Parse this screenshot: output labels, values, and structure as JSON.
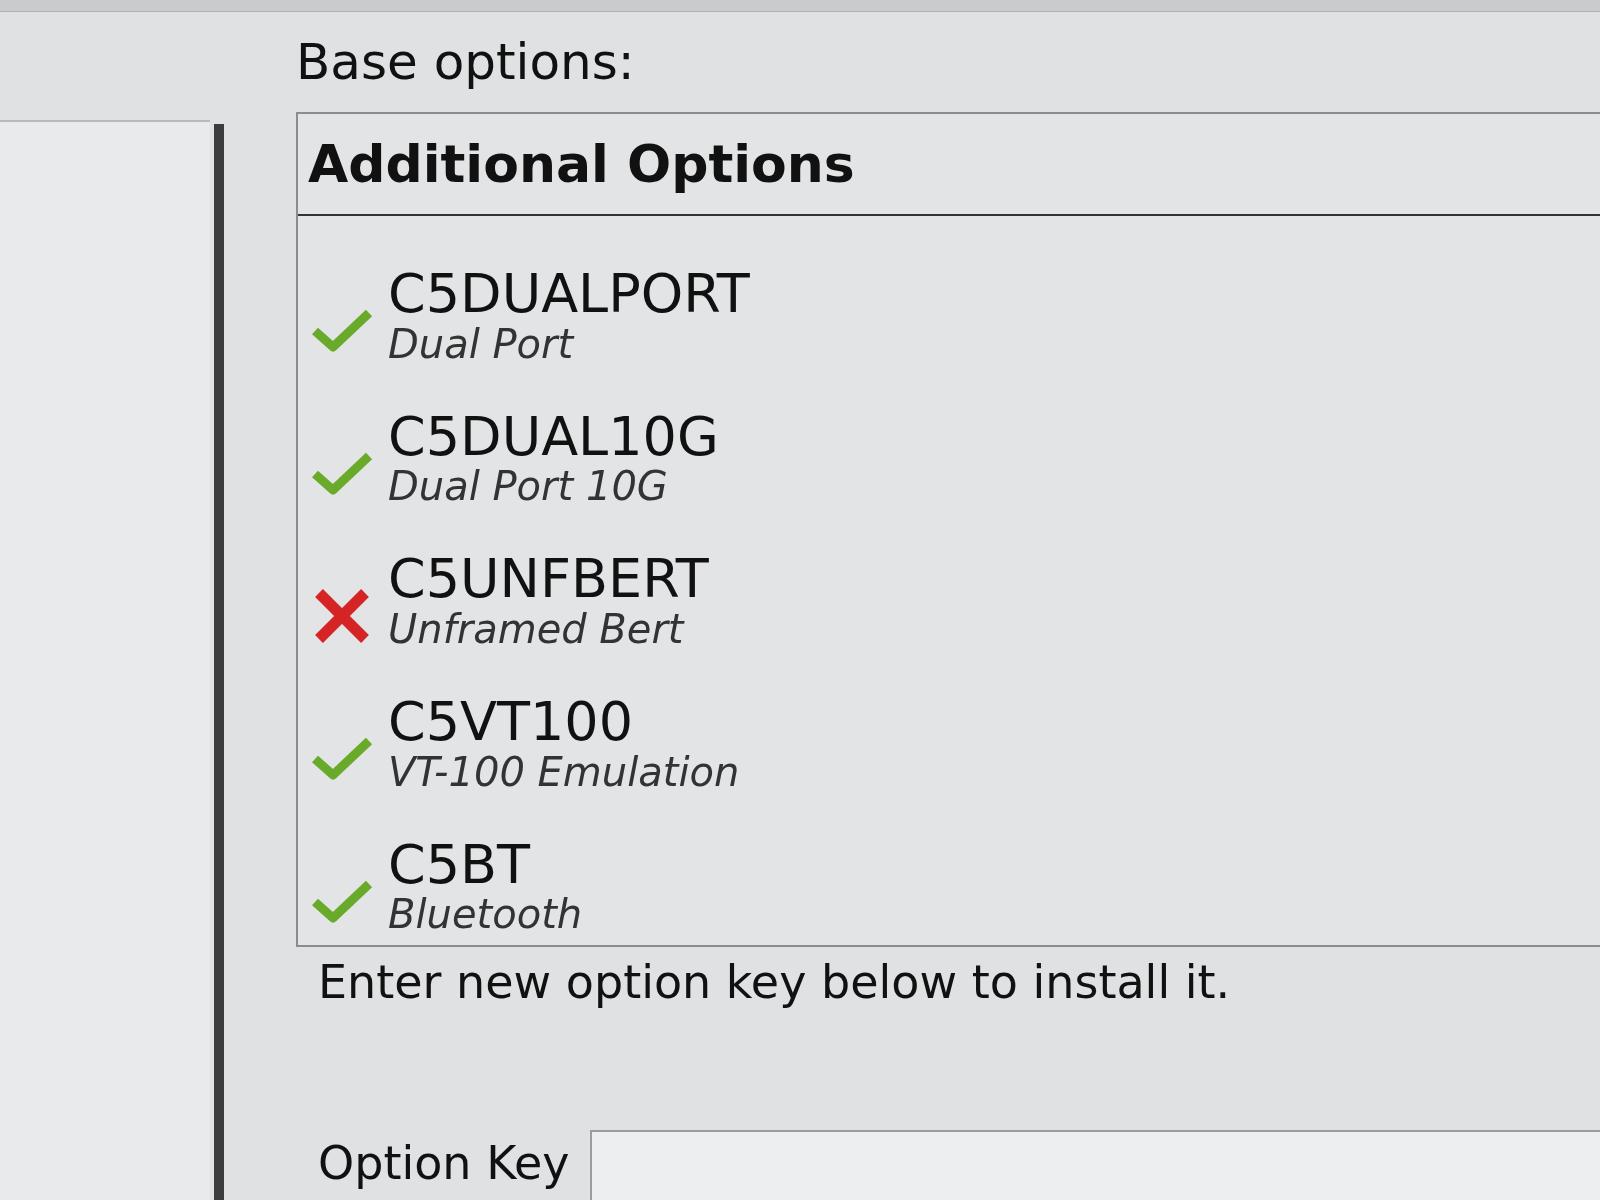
{
  "base_options_label": "Base options:",
  "options_panel": {
    "title": "Additional Options",
    "items": [
      {
        "code": "C5DUALPORT",
        "description": "Dual Port",
        "installed": true
      },
      {
        "code": "C5DUAL10G",
        "description": "Dual Port 10G",
        "installed": true
      },
      {
        "code": "C5UNFBERT",
        "description": "Unframed Bert",
        "installed": false
      },
      {
        "code": "C5VT100",
        "description": "VT-100 Emulation",
        "installed": true
      },
      {
        "code": "C5BT",
        "description": "Bluetooth",
        "installed": true
      }
    ]
  },
  "instruction": "Enter new option key below to install it.",
  "option_key": {
    "label": "Option Key"
  }
}
